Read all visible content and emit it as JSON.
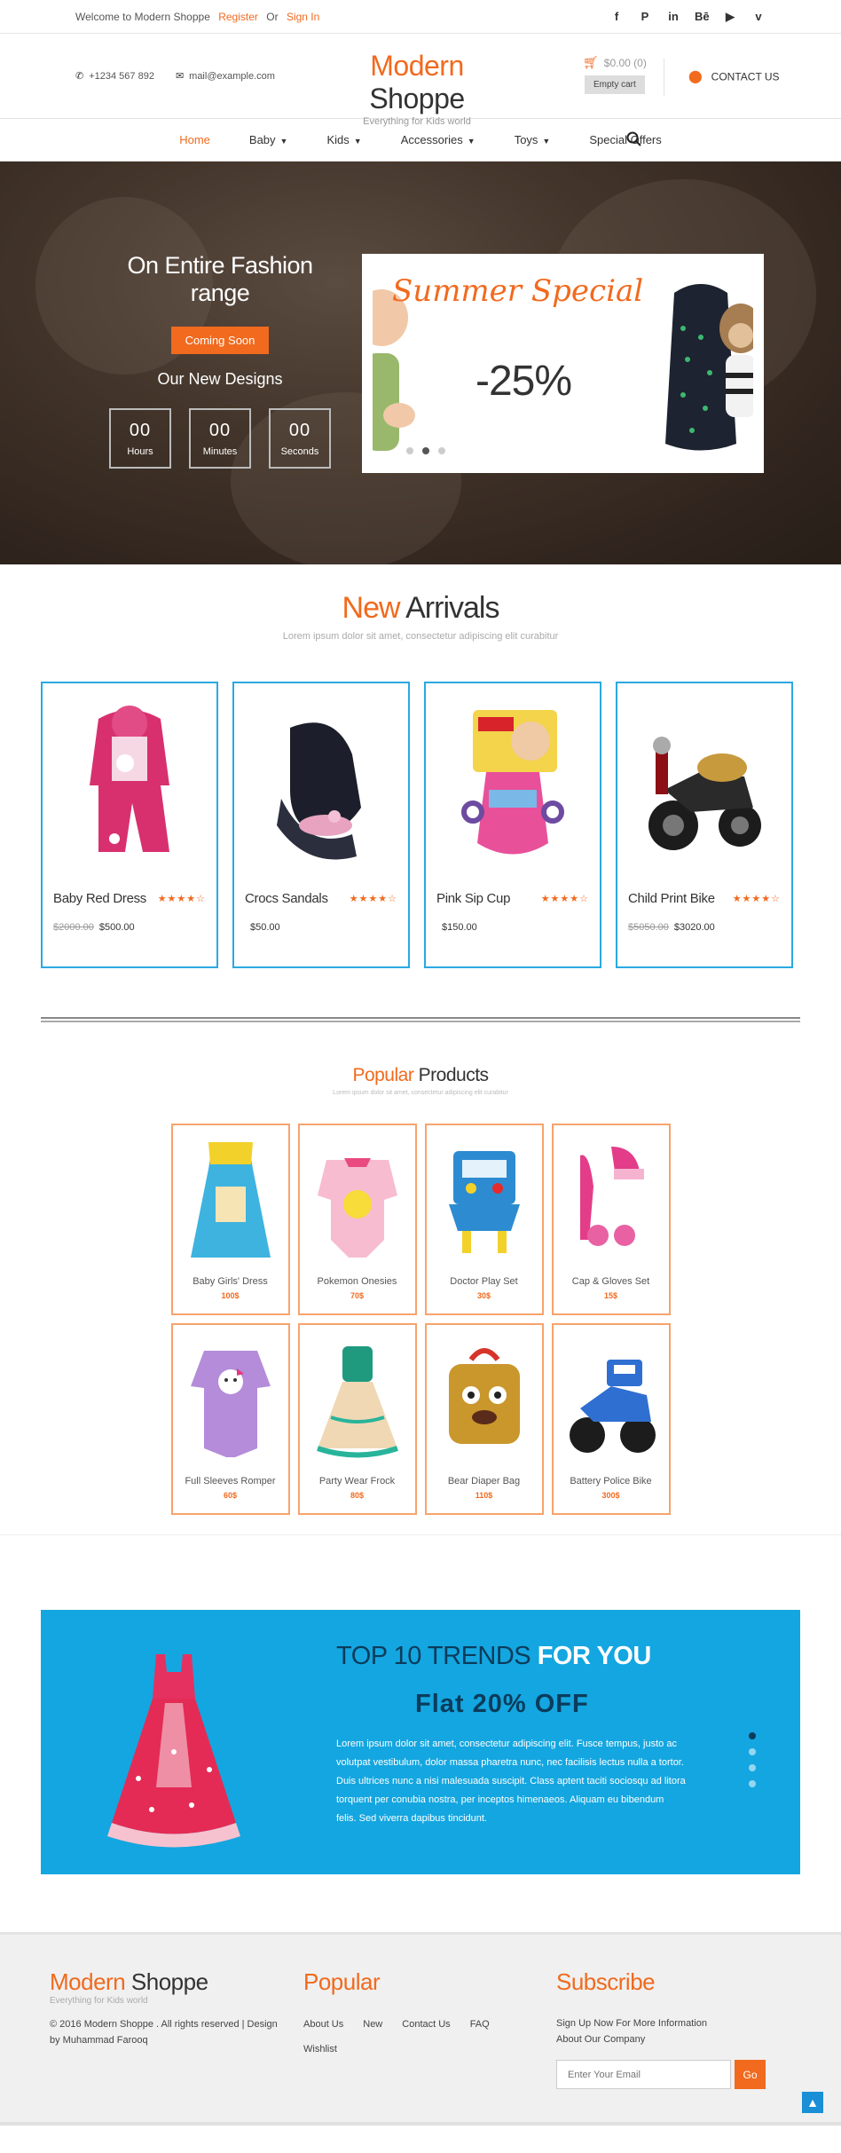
{
  "topbar": {
    "welcome": "Welcome to Modern Shoppe",
    "register": "Register",
    "or": "Or",
    "signin": "Sign In",
    "social": [
      "f",
      "P",
      "in",
      "Bē",
      "▶",
      "v"
    ]
  },
  "header": {
    "phone": "+1234 567 892",
    "email": "mail@example.com",
    "logo_a": "Modern",
    "logo_b": "Shoppe",
    "tagline": "Everything for Kids world",
    "cart_total": "$0.00 (0)",
    "empty_cart": "Empty cart",
    "contact": "CONTACT US"
  },
  "nav": {
    "items": [
      {
        "label": "Home",
        "caret": false
      },
      {
        "label": "Baby",
        "caret": true
      },
      {
        "label": "Kids",
        "caret": true
      },
      {
        "label": "Accessories",
        "caret": true
      },
      {
        "label": "Toys",
        "caret": true
      },
      {
        "label": "Special Offers",
        "caret": false
      }
    ]
  },
  "hero": {
    "heading": "On Entire Fashion range",
    "button": "Coming Soon",
    "subheading": "Our New Designs",
    "countdown": [
      {
        "value": "00",
        "unit": "Hours"
      },
      {
        "value": "00",
        "unit": "Minutes"
      },
      {
        "value": "00",
        "unit": "Seconds"
      }
    ],
    "banner_title": "Summer Special",
    "banner_discount": "-25%"
  },
  "arrivals": {
    "title_a": "New",
    "title_b": "Arrivals",
    "subtitle": "Lorem ipsum dolor sit amet, consectetur adipiscing elit curabitur",
    "products": [
      {
        "name": "Baby Red Dress",
        "old": "$2000.00",
        "price": "$500.00",
        "stars": "★★★★☆"
      },
      {
        "name": "Crocs Sandals",
        "old": "",
        "price": "$50.00",
        "stars": "★★★★☆"
      },
      {
        "name": "Pink Sip Cup",
        "old": "",
        "price": "$150.00",
        "stars": "★★★★☆"
      },
      {
        "name": "Child Print Bike",
        "old": "$5050.00",
        "price": "$3020.00",
        "stars": "★★★★☆"
      }
    ]
  },
  "popular": {
    "title_a": "Popular",
    "title_b": "Products",
    "subtitle": "Lorem ipsum dolor sit amet, consectetur adipiscing elit curabitur",
    "products": [
      {
        "name": "Baby Girls' Dress",
        "price": "100$"
      },
      {
        "name": "Pokemon Onesies",
        "price": "70$"
      },
      {
        "name": "Doctor Play Set",
        "price": "30$"
      },
      {
        "name": "Cap & Gloves Set",
        "price": "15$"
      },
      {
        "name": "Full Sleeves Romper",
        "price": "60$"
      },
      {
        "name": "Party Wear Frock",
        "price": "80$"
      },
      {
        "name": "Bear Diaper Bag",
        "price": "110$"
      },
      {
        "name": "Battery Police Bike",
        "price": "300$"
      }
    ]
  },
  "trends": {
    "title_a": "TOP 10 TRENDS",
    "title_b": "FOR YOU",
    "offer": "Flat 20% OFF",
    "text": "Lorem ipsum dolor sit amet, consectetur adipiscing elit. Fusce tempus, justo ac volutpat vestibulum, dolor massa pharetra nunc, nec facilisis lectus nulla a tortor. Duis ultrices nunc a nisi malesuada suscipit. Class aptent taciti sociosqu ad litora torquent per conubia nostra, per inceptos himenaeos. Aliquam eu bibendum felis. Sed viverra dapibus tincidunt."
  },
  "footer": {
    "logo_a": "Modern",
    "logo_b": "Shoppe",
    "tagline": "Everything for Kids world",
    "copyright": "© 2016 Modern Shoppe . All rights reserved | Design by Muhammad Farooq",
    "popular_heading": "Popular",
    "links": [
      "About Us",
      "New",
      "Contact Us",
      "FAQ",
      "Wishlist"
    ],
    "subscribe_heading": "Subscribe",
    "subscribe_text": "Sign Up Now For More Information About Our Company",
    "email_placeholder": "Enter Your Email",
    "go": "Go"
  },
  "colors": {
    "accent": "#f16a1e",
    "blue": "#29aae1",
    "trends_bg": "#14a6e0"
  }
}
